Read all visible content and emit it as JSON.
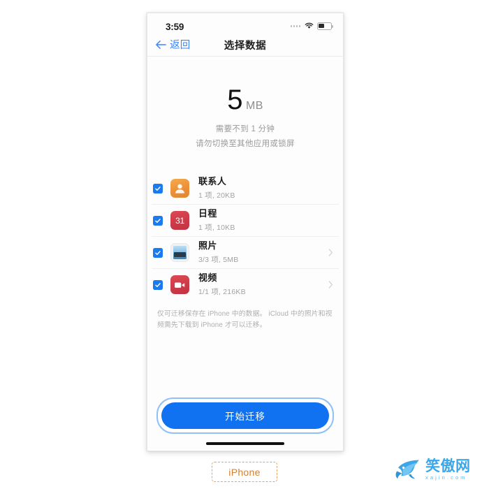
{
  "statusbar": {
    "time": "3:59",
    "signal_icon": "signal-dots-icon",
    "wifi_icon": "wifi-icon",
    "battery_icon": "battery-icon",
    "battery_level": 48
  },
  "navbar": {
    "back_icon": "back-arrow-icon",
    "back_label": "返回",
    "title": "选择数据"
  },
  "summary": {
    "size_value": "5",
    "size_unit": "MB",
    "time_estimate": "需要不到 1 分钟",
    "warning": "请勿切换至其他应用或锁屏"
  },
  "list": [
    {
      "name": "联系人",
      "detail": "1 项, 20KB",
      "icon": "contacts-icon",
      "checked": true,
      "has_chevron": false
    },
    {
      "name": "日程",
      "detail": "1 项, 10KB",
      "icon": "calendar-icon",
      "icon_text": "31",
      "checked": true,
      "has_chevron": false
    },
    {
      "name": "照片",
      "detail": "3/3 项, 5MB",
      "icon": "photos-icon",
      "checked": true,
      "has_chevron": true
    },
    {
      "name": "视频",
      "detail": "1/1 项, 216KB",
      "icon": "video-icon",
      "checked": true,
      "has_chevron": true
    }
  ],
  "note": "仅可迁移保存在 iPhone 中的数据。 iCloud 中的照片和视频需先下载到 iPhone 才可以迁移。",
  "footer": {
    "primary_button": "开始迁移"
  },
  "caption": {
    "label": "iPhone"
  },
  "watermark": {
    "logo_icon": "shark-logo-icon",
    "name_cn": "笑傲网",
    "name_en": "xajin.com"
  },
  "colors": {
    "accent_blue": "#1072f0",
    "link_blue": "#3d86f5",
    "focus_ring": "#8fc0f7",
    "caption_orange": "#cf8237",
    "watermark_blue": "#3ba7e8"
  }
}
